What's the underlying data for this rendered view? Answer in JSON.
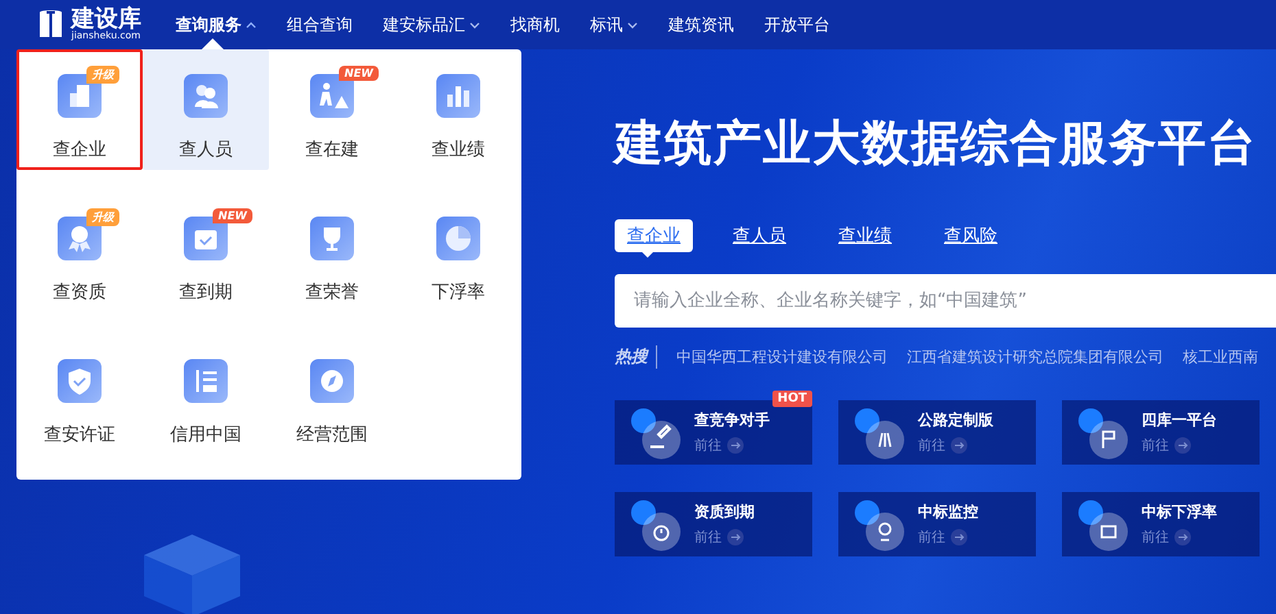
{
  "logo": {
    "name": "建设库",
    "domain": "jiansheku.com"
  },
  "nav": [
    {
      "label": "查询服务",
      "has_menu": true,
      "selected": true
    },
    {
      "label": "组合查询",
      "has_menu": false,
      "selected": false
    },
    {
      "label": "建安标品汇",
      "has_menu": true,
      "selected": false
    },
    {
      "label": "找商机",
      "has_menu": false,
      "selected": false
    },
    {
      "label": "标讯",
      "has_menu": true,
      "selected": false
    },
    {
      "label": "建筑资讯",
      "has_menu": false,
      "selected": false
    },
    {
      "label": "开放平台",
      "has_menu": false,
      "selected": false
    }
  ],
  "menu": {
    "expanded": true,
    "items": [
      {
        "label": "查企业",
        "badge": {
          "kind": "upgrade",
          "text": "升级"
        },
        "selected": true,
        "hovered": false
      },
      {
        "label": "查人员",
        "selected": false,
        "hovered": true
      },
      {
        "label": "查在建",
        "badge": {
          "kind": "new",
          "text": "NEW"
        },
        "selected": false,
        "hovered": false
      },
      {
        "label": "查业绩",
        "selected": false,
        "hovered": false
      },
      {
        "label": "查资质",
        "badge": {
          "kind": "upgrade",
          "text": "升级"
        },
        "selected": false,
        "hovered": false
      },
      {
        "label": "查到期",
        "badge": {
          "kind": "new",
          "text": "NEW"
        },
        "selected": false,
        "hovered": false
      },
      {
        "label": "查荣誉",
        "selected": false,
        "hovered": false
      },
      {
        "label": "下浮率",
        "selected": false,
        "hovered": false
      },
      {
        "label": "查安许证",
        "selected": false,
        "hovered": false
      },
      {
        "label": "信用中国",
        "selected": false,
        "hovered": false
      },
      {
        "label": "经营范围",
        "selected": false,
        "hovered": false
      }
    ]
  },
  "hero": {
    "title": "建筑产业大数据综合服务平台"
  },
  "search_tabs": [
    {
      "label": "查企业",
      "selected": true
    },
    {
      "label": "查人员",
      "selected": false
    },
    {
      "label": "查业绩",
      "selected": false
    },
    {
      "label": "查风险",
      "selected": false
    }
  ],
  "search": {
    "placeholder": "请输入企业全称、企业名称关键字，如“中国建筑”"
  },
  "hot_search": {
    "label": "热搜",
    "items": [
      "中国华西工程设计建设有限公司",
      "江西省建筑设计研究总院集团有限公司",
      "核工业西南"
    ]
  },
  "cards": [
    {
      "title": "查竞争对手",
      "link": "前往",
      "badge": "HOT"
    },
    {
      "title": "公路定制版",
      "link": "前往"
    },
    {
      "title": "四库一平台",
      "link": "前往"
    },
    {
      "title": "资质到期",
      "link": "前往"
    },
    {
      "title": "中标监控",
      "link": "前往"
    },
    {
      "title": "中标下浮率",
      "link": "前往"
    }
  ]
}
